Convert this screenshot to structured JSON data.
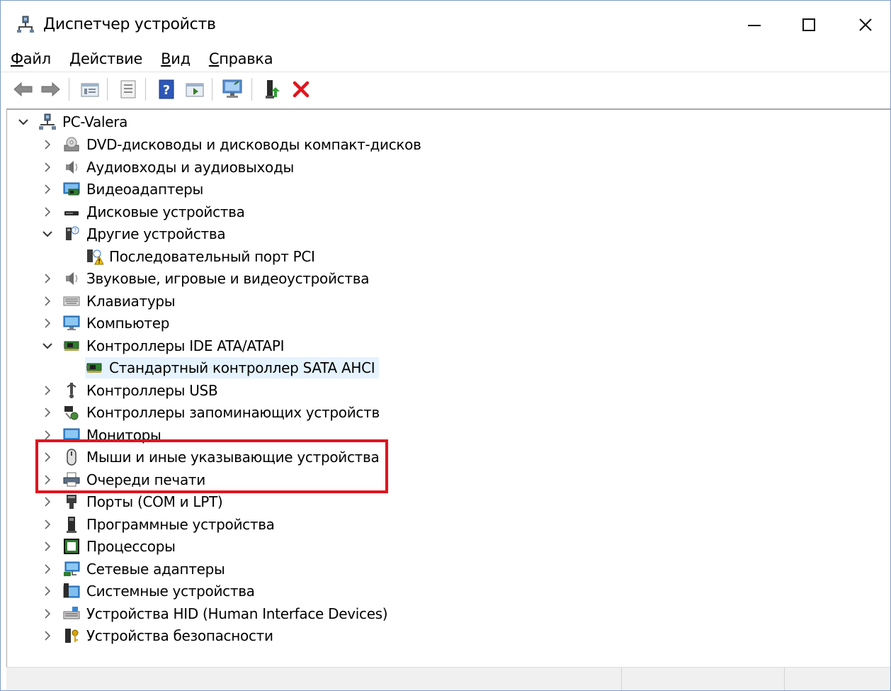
{
  "window": {
    "title": "Диспетчер устройств",
    "minimize_icon": "minimize-icon",
    "maximize_icon": "maximize-icon",
    "close_icon": "close-icon"
  },
  "menu": [
    {
      "accel": "Ф",
      "rest": "айл"
    },
    {
      "accel": "Д",
      "rest": "ействие"
    },
    {
      "accel": "В",
      "rest": "ид"
    },
    {
      "accel": "С",
      "rest": "правка"
    }
  ],
  "toolbar": {
    "icons": [
      "back-arrow-icon",
      "forward-arrow-icon",
      "properties-icon",
      "details-icon",
      "help-icon",
      "show-hidden-icon",
      "monitor-scan-icon",
      "update-driver-icon",
      "uninstall-icon"
    ],
    "uninstall_color": "#e0141e"
  },
  "tree": {
    "root": "PC-Valera",
    "items": [
      {
        "label": "DVD-дисководы и дисководы компакт-дисков",
        "icon": "dvd-drive-icon",
        "state": "collapsed"
      },
      {
        "label": "Аудиовходы и аудиовыходы",
        "icon": "speaker-icon",
        "state": "collapsed"
      },
      {
        "label": "Видеоадаптеры",
        "icon": "display-adapter-icon",
        "state": "collapsed"
      },
      {
        "label": "Дисковые устройства",
        "icon": "disk-drive-icon",
        "state": "collapsed"
      },
      {
        "label": "Другие устройства",
        "icon": "unknown-device-icon",
        "state": "expanded"
      },
      {
        "label": "Последовательный порт PCI",
        "icon": "warning-device-icon",
        "state": "child"
      },
      {
        "label": "Звуковые, игровые и видеоустройства",
        "icon": "speaker-icon",
        "state": "collapsed"
      },
      {
        "label": "Клавиатуры",
        "icon": "keyboard-icon",
        "state": "collapsed"
      },
      {
        "label": "Компьютер",
        "icon": "computer-icon",
        "state": "collapsed"
      },
      {
        "label": "Контроллеры IDE ATA/ATAPI",
        "icon": "ide-controller-icon",
        "state": "expanded"
      },
      {
        "label": "Стандартный контроллер SATA AHCI",
        "icon": "ide-controller-icon",
        "state": "child-selected"
      },
      {
        "label": "Контроллеры USB",
        "icon": "usb-icon",
        "state": "collapsed"
      },
      {
        "label": "Контроллеры запоминающих устройств",
        "icon": "storage-controller-icon",
        "state": "collapsed"
      },
      {
        "label": "Мониторы",
        "icon": "monitor-icon",
        "state": "collapsed"
      },
      {
        "label": "Мыши и иные указывающие устройства",
        "icon": "mouse-icon",
        "state": "collapsed"
      },
      {
        "label": "Очереди печати",
        "icon": "printer-icon",
        "state": "collapsed"
      },
      {
        "label": "Порты (COM и LPT)",
        "icon": "port-icon",
        "state": "collapsed"
      },
      {
        "label": "Программные устройства",
        "icon": "software-device-icon",
        "state": "collapsed"
      },
      {
        "label": "Процессоры",
        "icon": "processor-icon",
        "state": "collapsed"
      },
      {
        "label": "Сетевые адаптеры",
        "icon": "network-adapter-icon",
        "state": "collapsed"
      },
      {
        "label": "Системные устройства",
        "icon": "system-device-icon",
        "state": "collapsed"
      },
      {
        "label": "Устройства HID (Human Interface Devices)",
        "icon": "hid-icon",
        "state": "collapsed"
      },
      {
        "label": "Устройства безопасности",
        "icon": "security-device-icon",
        "state": "collapsed"
      }
    ]
  },
  "colors": {
    "selection": "#e5f3ff",
    "annotation_box": "#e0141e",
    "window_border": "#7a9cc6"
  }
}
